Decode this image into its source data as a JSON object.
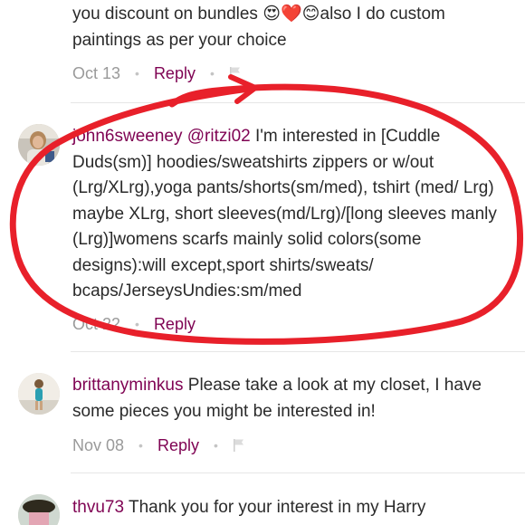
{
  "comments": [
    {
      "line1": "you discount  on bundles ",
      "emoji": "😍❤️😊",
      "line1b": "also I do custom",
      "line2": "paintings as per your choice",
      "date": "Oct 13",
      "reply": "Reply"
    },
    {
      "username": "john6sweeney",
      "mention": "@ritzi02",
      "text": " I'm interested in [Cuddle Duds(sm)] hoodies/sweatshirts zippers or w/out (Lrg/XLrg),yoga pants/shorts(sm/med), tshirt (med/ Lrg) maybe XLrg, short sleeves(md/Lrg)/[long sleeves manly (Lrg)]womens scarfs mainly solid colors(some designs):will except,sport shirts/sweats/ bcaps/JerseysUndies:sm/med",
      "date": "Oct 22",
      "reply": "Reply"
    },
    {
      "username": "brittanyminkus",
      "text": " Please take a look at my closet, I have some pieces you might be interested in!",
      "date": "Nov 08",
      "reply": "Reply"
    },
    {
      "username": "thvu73",
      "text": " Thank you for your interest in my Harry"
    }
  ],
  "colors": {
    "username": "#7f0353",
    "annotation": "#e8202a",
    "meta": "#9a9a9a"
  },
  "icons": {
    "flag": "flag-icon",
    "separator": "dot"
  }
}
